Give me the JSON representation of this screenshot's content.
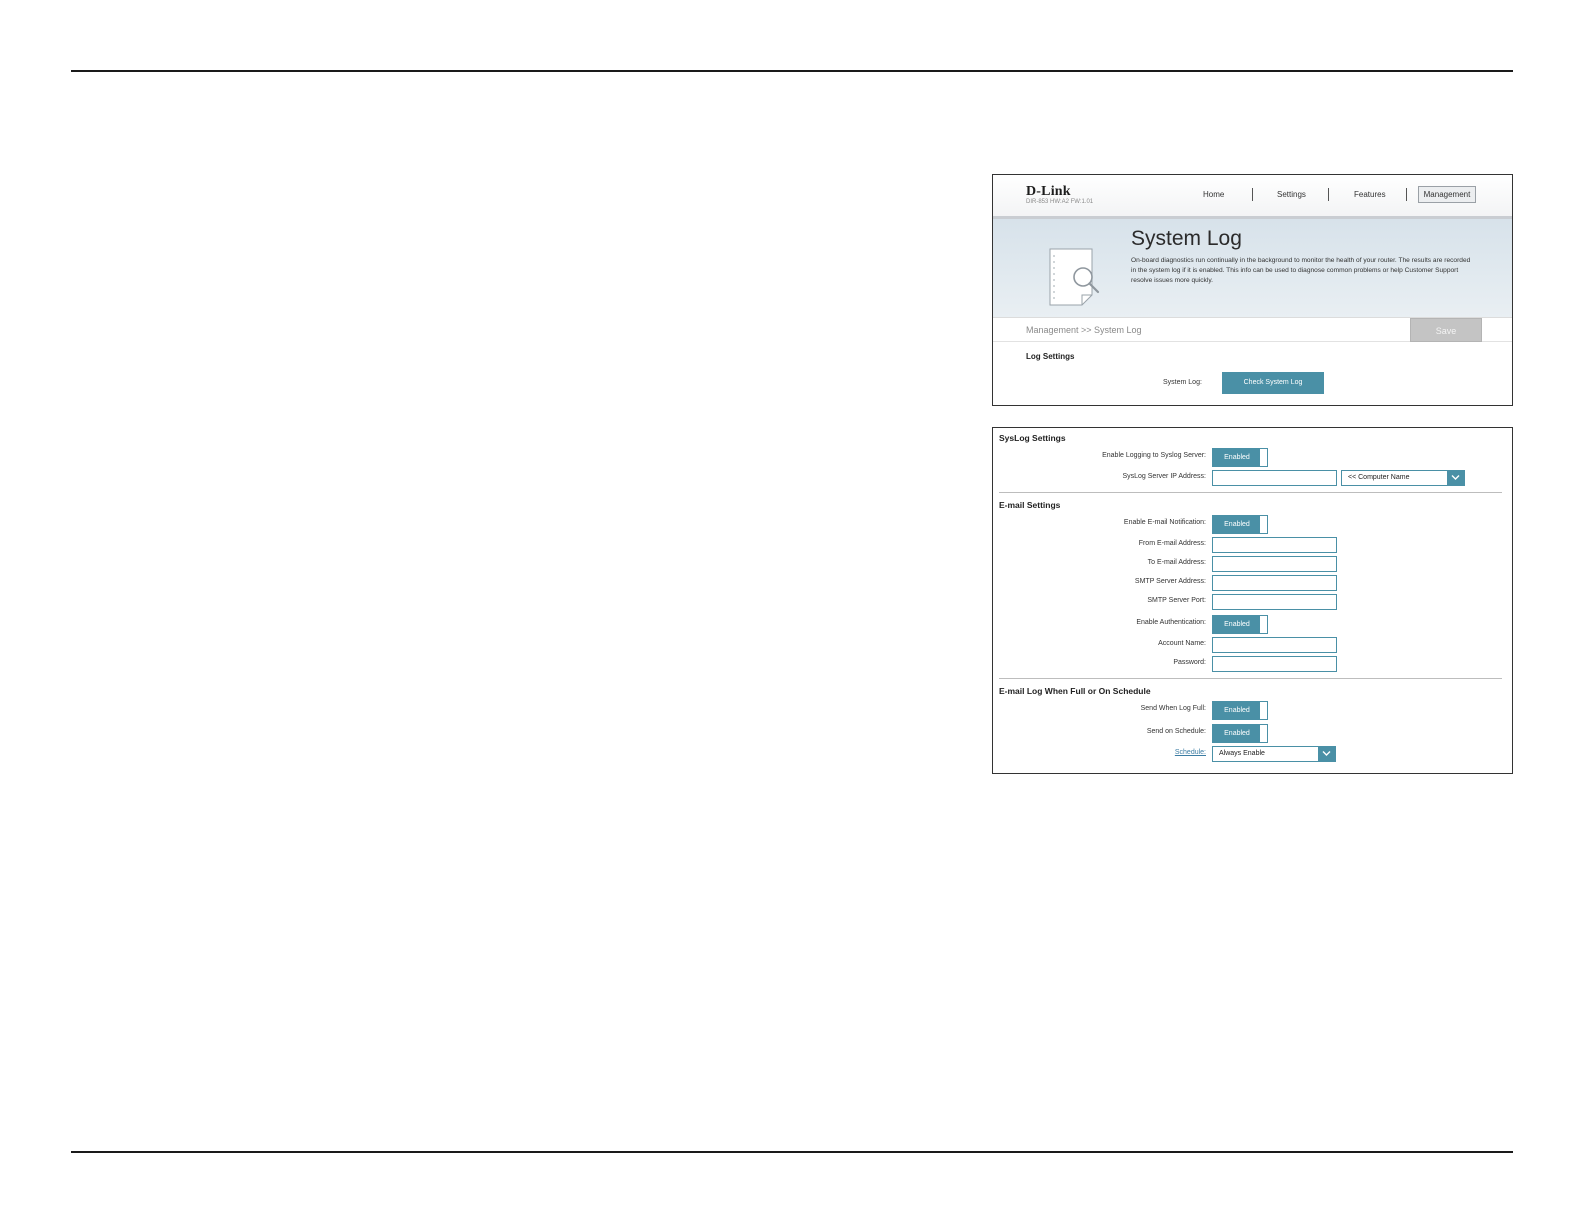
{
  "header": {
    "logo": "D-Link",
    "model": "DIR-853 HW:A2 FW:1.01",
    "nav": [
      "Home",
      "Settings",
      "Features",
      "Management"
    ]
  },
  "banner": {
    "title": "System Log",
    "description": "On-board diagnostics run continually in the background to monitor the health of your router. The results are recorded in the system log if it is enabled. This info can be used to diagnose common problems or help Customer Support resolve issues more quickly."
  },
  "breadcrumb": "Management >> System Log",
  "save_label": "Save",
  "log_settings": {
    "title": "Log Settings",
    "system_log_label": "System Log:",
    "check_button": "Check System Log"
  },
  "syslog": {
    "title": "SysLog Settings",
    "enable_label": "Enable Logging to Syslog Server:",
    "enable_value": "Enabled",
    "ip_label": "SysLog Server IP Address:",
    "ip_value": "",
    "computer_name": "<< Computer Name"
  },
  "email": {
    "title": "E-mail Settings",
    "enable_label": "Enable E-mail Notification:",
    "enable_value": "Enabled",
    "from_label": "From E-mail Address:",
    "to_label": "To E-mail Address:",
    "smtp_addr_label": "SMTP Server Address:",
    "smtp_port_label": "SMTP Server Port:",
    "auth_label": "Enable Authentication:",
    "auth_value": "Enabled",
    "account_label": "Account Name:",
    "password_label": "Password:"
  },
  "schedule": {
    "title": "E-mail Log When Full or On Schedule",
    "full_label": "Send When Log Full:",
    "full_value": "Enabled",
    "on_schedule_label": "Send on Schedule:",
    "on_schedule_value": "Enabled",
    "schedule_label": "Schedule:",
    "schedule_value": "Always Enable"
  },
  "colors": {
    "accent": "#4a90a6",
    "save_disabled": "#c4c4c4",
    "banner": "#dce6ed"
  }
}
